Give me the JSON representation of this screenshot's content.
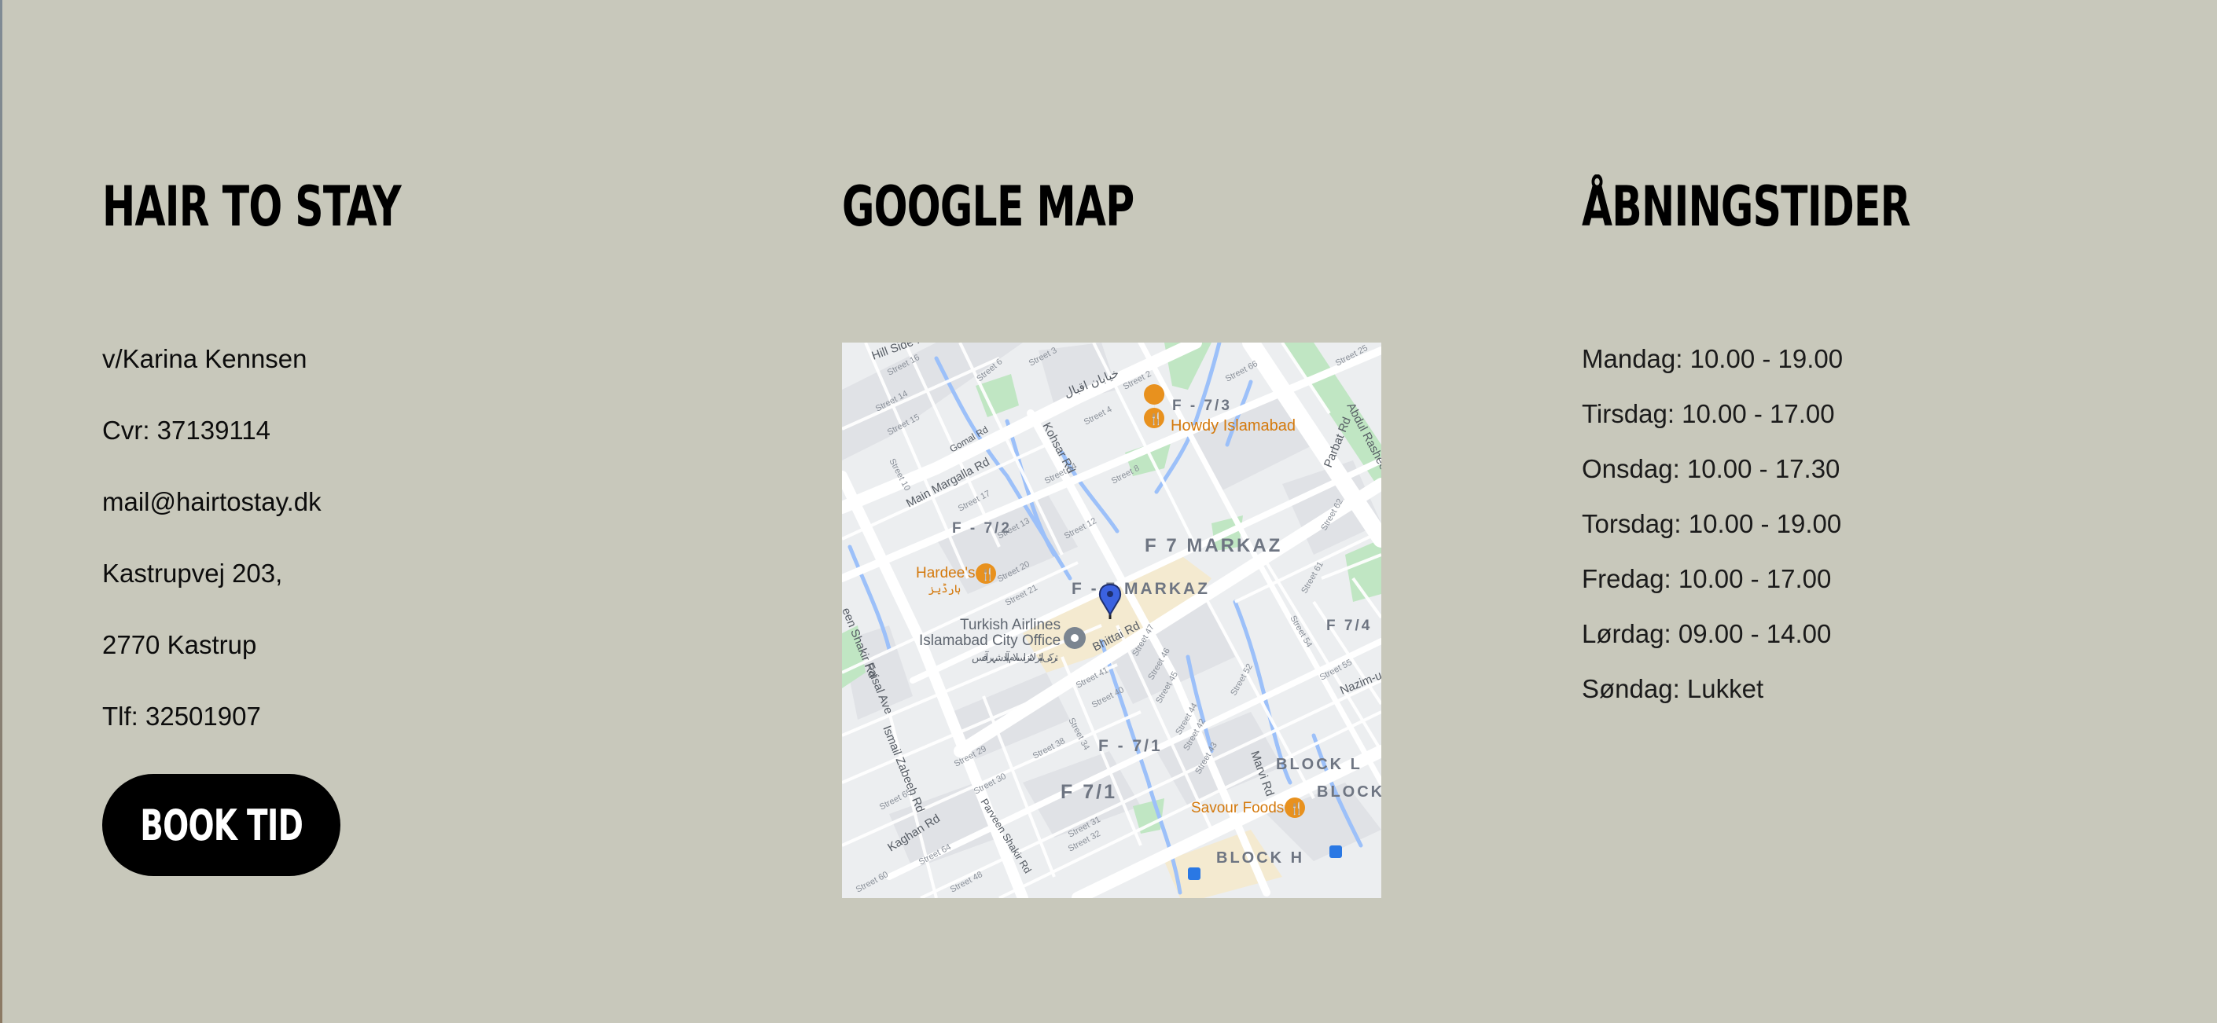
{
  "info": {
    "heading": "HAIR TO STAY",
    "lines": [
      "v/Karina Kennsen",
      "Cvr: 37139114",
      "mail@hairtostay.dk",
      "Kastrupvej 203,",
      "2770 Kastrup",
      "Tlf: 32501907"
    ],
    "book_label": "BOOK TID"
  },
  "map": {
    "heading": "GOOGLE MAP",
    "labels": {
      "f73": "F - 7/3",
      "howdy": "Howdy Islamabad",
      "f72": "F - 7/2",
      "f7markaz": "F 7 MARKAZ",
      "f7markaz2": "F - 7 MARKAZ",
      "hardees": "Hardee's",
      "hardees_ur": "ہارڈیز",
      "turkish1": "Turkish Airlines",
      "turkish2": "Islamabad City Office",
      "turkish_ur": "ترکی ایئر لائنز اسلام آباد شہر آفس",
      "f74": "F 7/4",
      "f71a": "F - 7/1",
      "f71b": "F 7/1",
      "blockl": "BLOCK L",
      "block": "BLOCK",
      "blockh": "BLOCK H",
      "savour": "Savour Foods",
      "hill_side": "Hill Side Rd",
      "main_margalla": "Main Margalla Rd",
      "kohsar": "Kohsar Rd",
      "bhittai": "Bhittai Rd",
      "faisal": "Faisal Ave",
      "ismail": "Ismail Zabeeh Rd",
      "kaghan": "Kaghan Rd",
      "marvi": "Marvi Rd",
      "parbat": "Parbat Rd",
      "abdul": "Abdul Rasheed",
      "nazim": "Nazim-u",
      "shakar": "Parveen Shakir Rd",
      "shakir_rd": "een Shakir Rd",
      "khayaban": "خیابان اقبال",
      "gomal": "Gomal Rd",
      "s14": "Street 14",
      "s15": "Street 15",
      "s16": "Street 16",
      "s10": "Street 10",
      "s3": "Street 3",
      "s6": "Street 6",
      "s2": "Street 2",
      "s4": "Street 4",
      "s66": "Street 66",
      "s8": "Street 8",
      "s9": "Street 9",
      "s13": "Street 13",
      "s14b": "Street 14",
      "s12": "Street 12",
      "s17": "Street 17",
      "s13b": "Street 13",
      "s20": "Street 20",
      "s21": "Street 21",
      "s47": "Street 47",
      "s46": "Street 46",
      "s45": "Street 45",
      "s41": "Street 41",
      "s40": "Street 40",
      "s34": "Street 34",
      "s52": "Street 52",
      "s44": "Street 44",
      "s42": "Street 42",
      "s43": "Street 43",
      "s38": "Street 38",
      "s29": "Street 29",
      "s30": "Street 30",
      "s31": "Street 31",
      "s32": "Street 32",
      "s65": "Street 65",
      "s64": "Street 64",
      "s60": "Street 60",
      "s48": "Street 48",
      "s55": "Street 55",
      "s25": "Street 25",
      "s61": "Street 61",
      "s62": "Street 62",
      "s54": "Street 54"
    }
  },
  "hours": {
    "heading": "ÅBNINGSTIDER",
    "lines": [
      "Mandag: 10.00 - 19.00",
      "Tirsdag: 10.00 - 17.00",
      "Onsdag: 10.00 - 17.30",
      "Torsdag: 10.00 - 19.00",
      "Fredag: 10.00 - 17.00",
      "Lørdag: 09.00 - 14.00",
      "Søndag: Lukket"
    ]
  },
  "colors": {
    "background": "#c8c8bb",
    "button": "#000000",
    "map_base": "#eceef0",
    "water": "#9cc0f9",
    "park": "#c0e6c3",
    "poi_orange": "#e8911e",
    "pin_blue": "#3b62e0"
  }
}
